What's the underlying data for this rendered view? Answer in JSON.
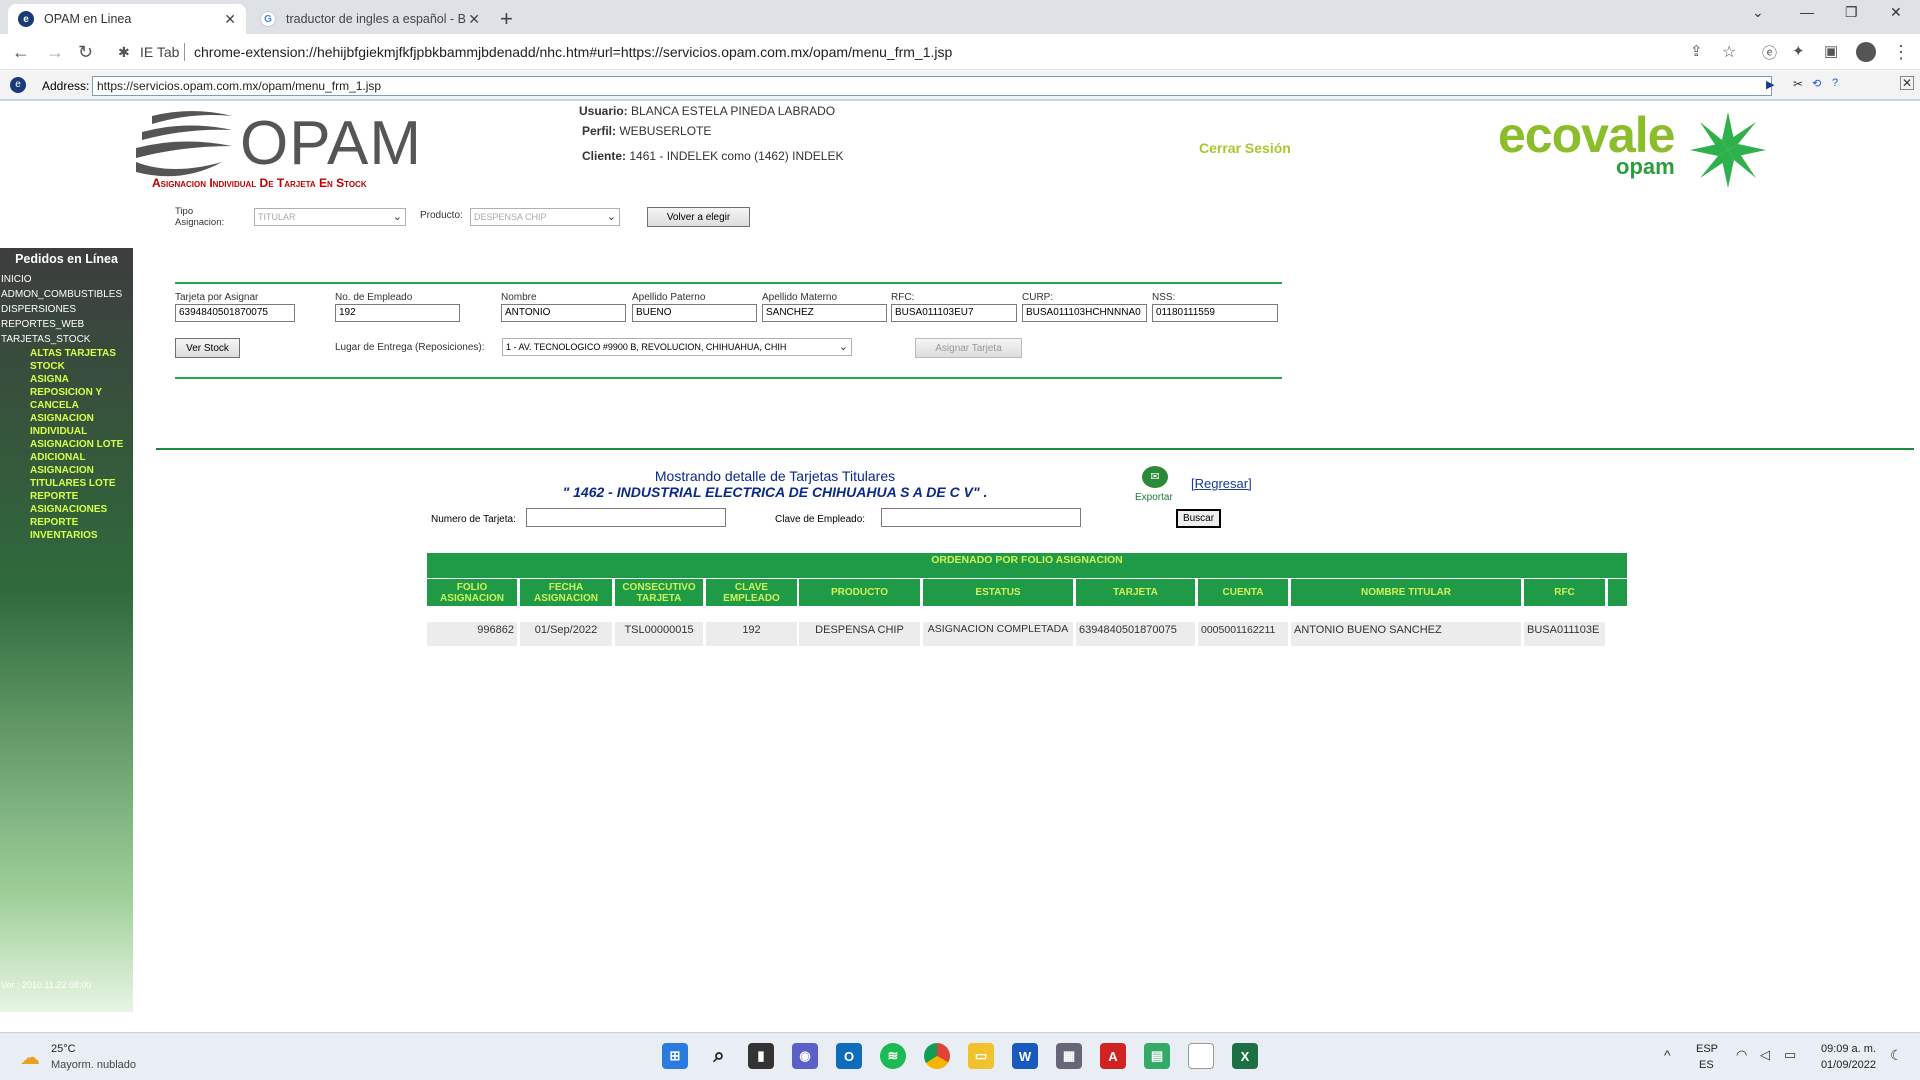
{
  "browser": {
    "tabs": [
      {
        "label": "OPAM en Linea"
      },
      {
        "label": "traductor de ingles a español - B"
      }
    ],
    "url": "chrome-extension://hehijbfgiekmjfkfjpbkbammjbdenadd/nhc.htm#url=https://servicios.opam.com.mx/opam/menu_frm_1.jsp",
    "ie_tab_label": "IE Tab",
    "address_label": "Address:",
    "address_value": "https://servicios.opam.com.mx/opam/menu_frm_1.jsp"
  },
  "header": {
    "brand": "OPAM",
    "usuario_label": "Usuario:",
    "usuario_value": "BLANCA ESTELA PINEDA LABRADO",
    "perfil_label": "Perfil:",
    "perfil_value": "WEBUSERLOTE",
    "cliente_label": "Cliente:",
    "cliente_value": "1461 - INDELEK como (1462) INDELEK",
    "cerrar_sesion": "Cerrar Sesión",
    "ecovale": "ecovale",
    "ecovale_sub": "opam"
  },
  "page_title": "Asignacion Individual De Tarjeta En Stock",
  "sidebar": {
    "title": "Pedidos en Línea",
    "items": [
      "Inicio",
      "Admon_Combustibles",
      "Dispersiones",
      "Reportes_Web",
      "Tarjetas_Stock"
    ],
    "subitems": [
      "Altas Tarjetas Stock",
      "Asigna Reposicion Y Cancela",
      "Asignacion Individual",
      "Asignacion Lote Adicional",
      "Asignacion Titulares Lote",
      "Reporte Asignaciones",
      "Reporte Inventarios"
    ],
    "version": "Ver : 2010.11.22 08:00"
  },
  "form": {
    "tipo_label": "Tipo Asignacion:",
    "tipo_value": "TITULAR",
    "producto_label": "Producto:",
    "producto_value": "DESPENSA CHIP",
    "volver_button": "Volver a elegir",
    "tarjeta_label": "Tarjeta por Asignar",
    "tarjeta_value": "6394840501870075",
    "empleado_label": "No. de Empleado",
    "empleado_value": "192",
    "nombre_label": "Nombre",
    "nombre_value": "ANTONIO",
    "paterno_label": "Apellido Paterno",
    "paterno_value": "BUENO",
    "materno_label": "Apellido Materno",
    "materno_value": "SANCHEZ",
    "rfc_label": "RFC:",
    "rfc_value": "BUSA011103EU7",
    "curp_label": "CURP:",
    "curp_value": "BUSA011103HCHNNNA0",
    "nss_label": "NSS:",
    "nss_value": "01180111559",
    "ver_stock_button": "Ver Stock",
    "lugar_label": "Lugar de Entrega (Reposiciones):",
    "lugar_value": "1 - AV. TECNOLOGICO #9900 B, REVOLUCION, CHIHUAHUA, CHIH",
    "asignar_button": "Asignar Tarjeta"
  },
  "detalle": {
    "heading": "Mostrando detalle de Tarjetas Titulares",
    "company": "\" 1462 - INDUSTRIAL ELECTRICA DE CHIHUAHUA S A DE C V\" .",
    "exportar": "Exportar",
    "regresar": "[Regresar]",
    "numero_label": "Numero de Tarjeta:",
    "clave_label": "Clave de Empleado:",
    "buscar_button": "Buscar",
    "ordenado": "ORDENADO POR FOLIO ASIGNACION",
    "columns": [
      "FOLIO ASIGNACION",
      "FECHA ASIGNACION",
      "CONSECUTIVO TARJETA",
      "CLAVE EMPLEADO",
      "PRODUCTO",
      "ESTATUS",
      "TARJETA",
      "CUENTA",
      "NOMBRE TITULAR",
      "RFC",
      ""
    ],
    "rows": [
      [
        "996862",
        "01/Sep/2022",
        "TSL00000015",
        "192",
        "DESPENSA CHIP",
        "ASIGNACION COMPLETADA",
        "6394840501870075",
        "0005001162211",
        "ANTONIO BUENO SANCHEZ",
        "BUSA011103E"
      ]
    ]
  },
  "taskbar": {
    "weather_temp": "25°C",
    "weather_desc": "Mayorm. nublado",
    "lang_top": "ESP",
    "lang_bottom": "ES",
    "time": "09:09 a. m.",
    "date": "01/09/2022"
  },
  "colors": {
    "green": "#1f9a46",
    "lime": "#cff25a",
    "red_title": "#c00000",
    "navy": "#0a2a8a"
  }
}
